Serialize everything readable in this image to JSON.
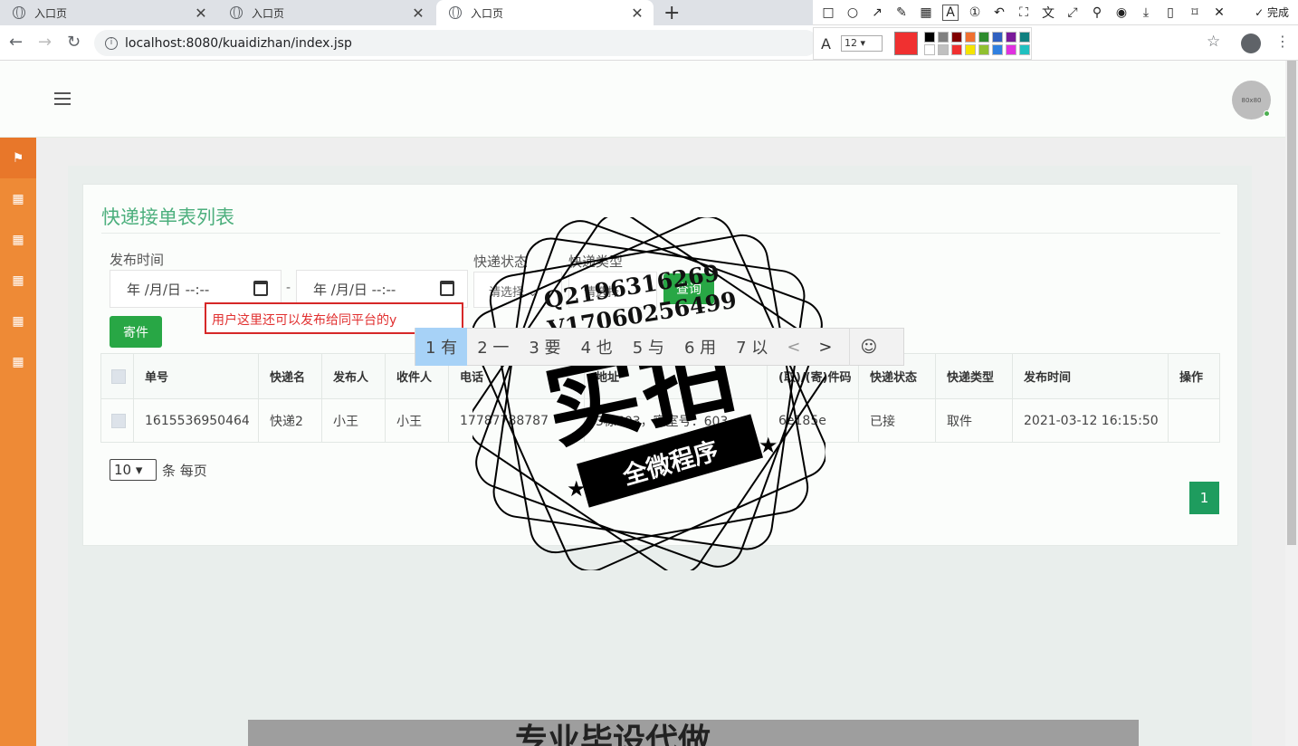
{
  "browser": {
    "tabs": [
      {
        "title": "入口页"
      },
      {
        "title": "入口页"
      },
      {
        "title": "入口页"
      }
    ],
    "url": "localhost:8080/kuaidizhan/index.jsp"
  },
  "annotation_toolbar": {
    "done_label": "完成",
    "font_size": "12",
    "current_color": "#f03030",
    "palette": [
      "#000000",
      "#808080",
      "#800000",
      "#f07030",
      "#2e8b2e",
      "#3060c0",
      "#7a1a9a",
      "#108080",
      "#ffffff",
      "#c0c0c0",
      "#f03030",
      "#f5e400",
      "#90c030",
      "#3080e0",
      "#e030e0",
      "#20c0c0"
    ]
  },
  "header": {
    "avatar_text": "80x80"
  },
  "sidebar": {
    "items": [
      {
        "icon": "flag-icon"
      },
      {
        "icon": "grid-icon"
      },
      {
        "icon": "grid-icon"
      },
      {
        "icon": "grid-icon"
      },
      {
        "icon": "grid-icon"
      },
      {
        "icon": "grid-icon"
      }
    ]
  },
  "page": {
    "title": "快递接单表列表",
    "filters": {
      "publish_time_label": "发布时间",
      "date_placeholder": "年 /月/日 --:--",
      "range_separator": "-",
      "status_label": "快递状态",
      "status_placeholder": "请选择",
      "type_label": "快递类型",
      "type_placeholder": "请选择",
      "query_button": "查询"
    },
    "send_button": "寄件",
    "annotation_text": "用户这里还可以发布给同平台的y",
    "ime": {
      "candidates": [
        "1 有",
        "2 一",
        "3 要",
        "4 也",
        "5 与",
        "6 用",
        "7 以"
      ],
      "prev": "<",
      "next": ">",
      "emoji": "☺"
    },
    "table": {
      "columns": [
        "单号",
        "快递名",
        "发布人",
        "收件人",
        "电话",
        "地址",
        "(取)/(寄)件码",
        "快递状态",
        "快递类型",
        "发布时间",
        "操作"
      ],
      "rows": [
        {
          "order_no": "1615536950464",
          "courier": "快递2",
          "publisher": "小王",
          "recipient": "小王",
          "phone": "17787788787",
          "address": "3栋603，寝室号：603",
          "code": "6e185e",
          "status": "已接",
          "type": "取件",
          "time": "2021-03-12 16:15:50",
          "action": ""
        }
      ]
    },
    "page_size": "10",
    "page_size_label": "条 每页",
    "current_page": "1"
  },
  "watermark": {
    "line1": "Q2196316269",
    "line2": "V17060256499",
    "big": "实拍",
    "banner": "全微程序",
    "bottom": "专业毕设代做"
  }
}
